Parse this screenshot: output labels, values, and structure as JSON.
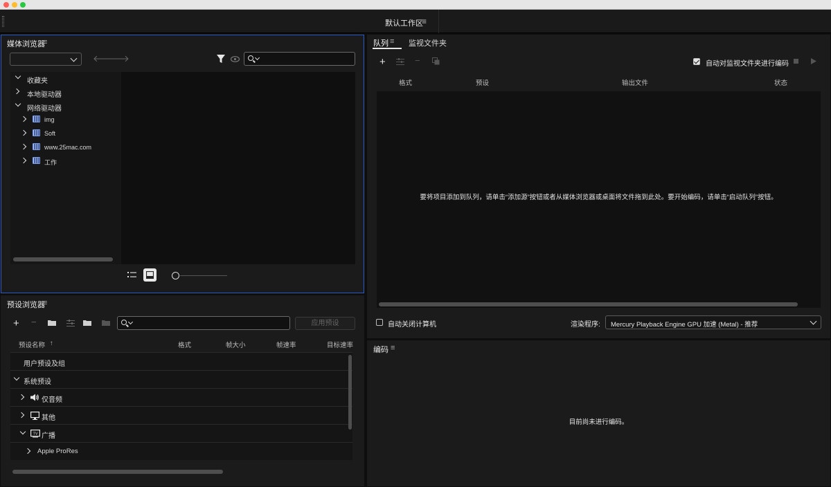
{
  "workspace": {
    "title": "默认工作区",
    "menu_glyph": "≡"
  },
  "media_browser": {
    "title": "媒体浏览器",
    "menu_glyph": "≡",
    "location_value": "",
    "search_value": "",
    "tree": [
      {
        "label": "收藏夹",
        "expanded": true,
        "level": 0
      },
      {
        "label": "本地驱动器",
        "expanded": false,
        "level": 0
      },
      {
        "label": "网络驱动器",
        "expanded": true,
        "level": 0
      },
      {
        "label": "img",
        "expanded": false,
        "level": 1,
        "icon": "network-drive-icon"
      },
      {
        "label": "Soft",
        "expanded": false,
        "level": 1,
        "icon": "network-drive-icon"
      },
      {
        "label": "www.25mac.com",
        "expanded": false,
        "level": 1,
        "icon": "network-drive-icon"
      },
      {
        "label": "工作",
        "expanded": false,
        "level": 1,
        "icon": "network-drive-icon"
      }
    ]
  },
  "preset_browser": {
    "title": "预设浏览器",
    "menu_glyph": "≡",
    "search_value": "",
    "apply_label": "应用预设",
    "columns": {
      "name": "预设名称",
      "format": "格式",
      "frame_size": "帧大小",
      "frame_rate": "帧速率",
      "target_rate": "目标速率"
    },
    "sort_glyph": "↑",
    "rows": [
      {
        "label": "用户预设及组"
      },
      {
        "label": "系统预设"
      },
      {
        "label": "仅音频"
      },
      {
        "label": "其他"
      },
      {
        "label": "广播"
      },
      {
        "label": "Apple ProRes"
      }
    ]
  },
  "queue": {
    "tab_queue": "队列",
    "tab_watch": "监视文件夹",
    "menu_glyph": "≡",
    "auto_encode_label": "自动对监视文件夹进行编码",
    "auto_encode_checked": true,
    "columns": {
      "format": "格式",
      "preset": "预设",
      "output": "输出文件",
      "status": "状态"
    },
    "hint": "要将项目添加到队列，请单击“添加源”按钮或者从媒体浏览器或桌面将文件拖到此处。要开始编码，请单击“启动队列”按钮。",
    "shutdown_label": "自动关闭计算机",
    "shutdown_checked": false,
    "renderer_label": "渲染程序:",
    "renderer_value": "Mercury Playback Engine GPU 加速 (Metal) - 推荐"
  },
  "encoding": {
    "title": "编码",
    "menu_glyph": "≡",
    "empty_text": "目前尚未进行编码。"
  },
  "colors": {
    "accent": "#2b5ac9",
    "panel": "#1b1b1b",
    "well": "#111111"
  }
}
